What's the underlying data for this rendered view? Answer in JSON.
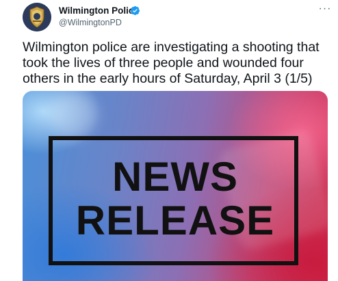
{
  "account": {
    "name": "Wilmington Police",
    "handle": "@WilmingtonPD",
    "verified": true
  },
  "menu": {
    "more_label": "···"
  },
  "tweet": {
    "text": "Wilmington police are investigating a shooting that took the lives of three people and wounded four others in the early hours of Saturday, April 3 (1/5)"
  },
  "media": {
    "line1": "NEWS",
    "line2": "RELEASE"
  },
  "colors": {
    "text": "#0f1419",
    "secondary": "#536471",
    "verified": "#1d9bf0"
  },
  "icons": {
    "avatar": "police-badge-icon",
    "verified": "verified-badge-icon",
    "more": "more-options-icon"
  }
}
